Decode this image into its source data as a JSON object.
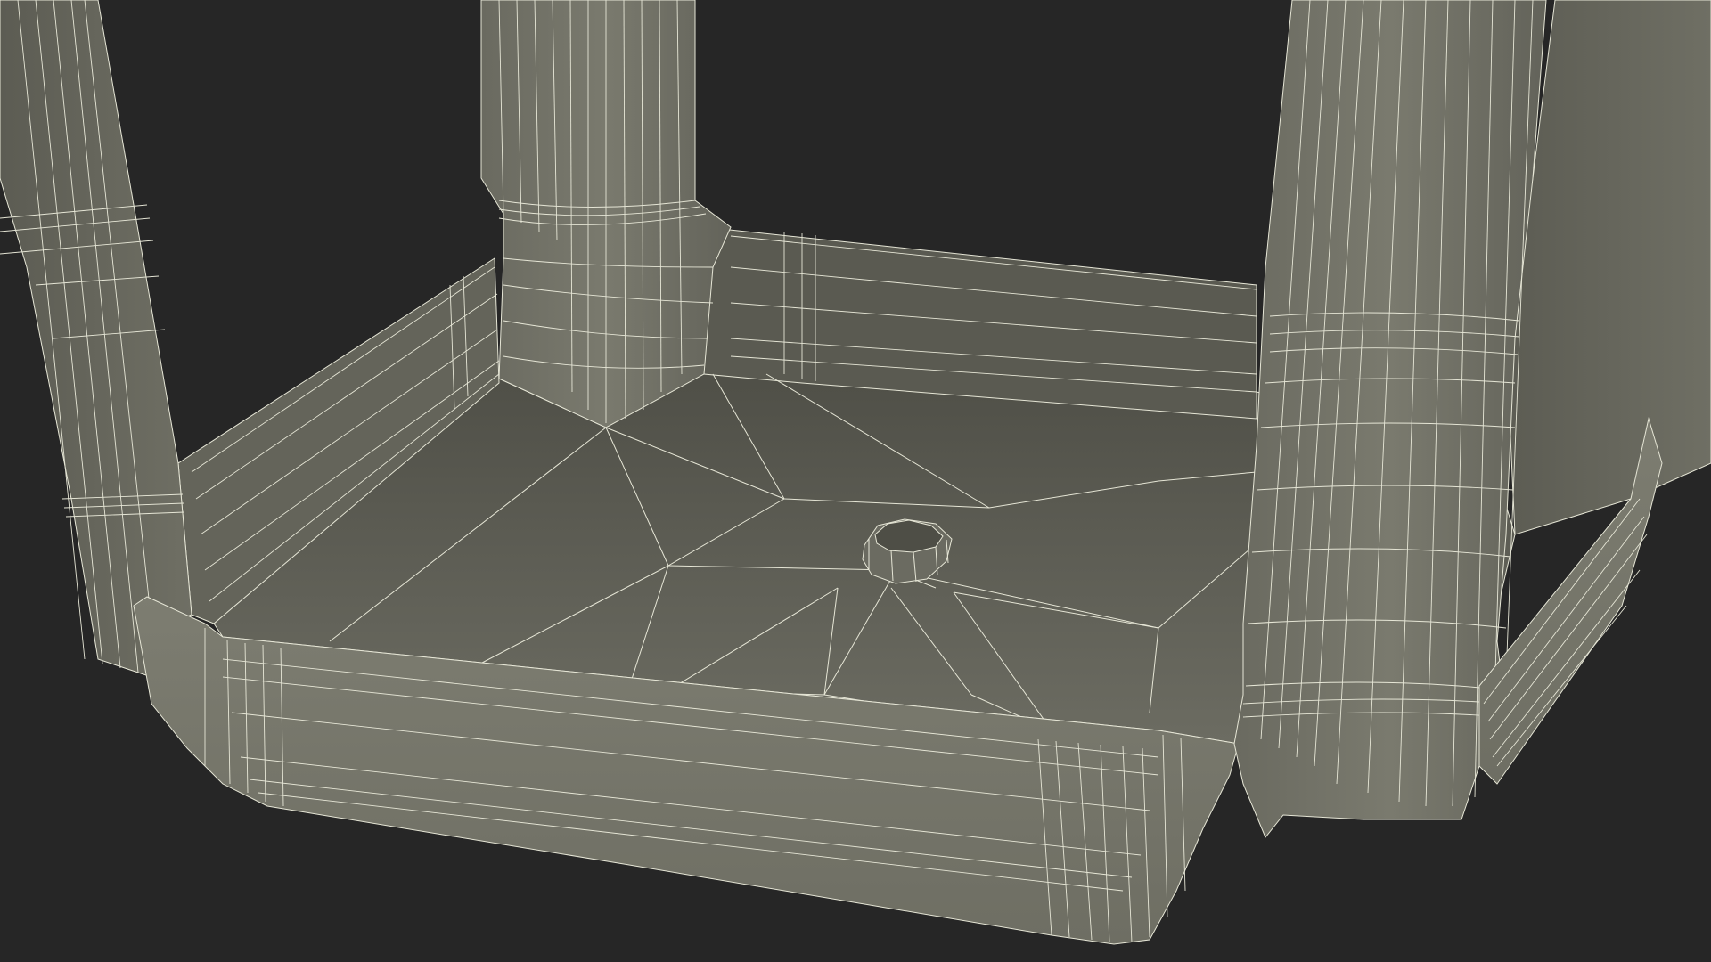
{
  "scene": {
    "subject": "wireframe-render-of-stool-underside",
    "colors": {
      "background": "#262626",
      "surface_light": "#7c7c70",
      "surface_mid": "#6a6a60",
      "surface_dark": "#55554c",
      "wire": "#e6e6d6"
    }
  }
}
